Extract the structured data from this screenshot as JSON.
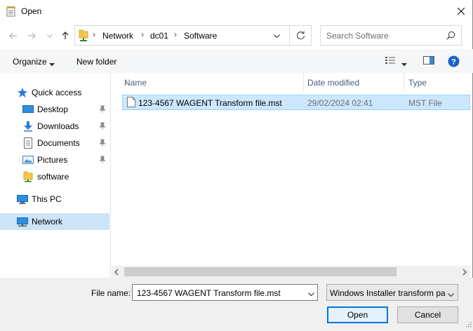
{
  "window": {
    "title": "Open"
  },
  "address": {
    "crumbs": [
      "Network",
      "dc01",
      "Software"
    ]
  },
  "search": {
    "placeholder": "Search Software"
  },
  "commands": {
    "organize": "Organize",
    "new_folder": "New folder"
  },
  "sidebar": {
    "items": [
      {
        "label": "Quick access",
        "icon": "star-icon"
      },
      {
        "label": "Desktop",
        "icon": "desktop-icon",
        "pinned": true
      },
      {
        "label": "Downloads",
        "icon": "download-icon",
        "pinned": true
      },
      {
        "label": "Documents",
        "icon": "documents-icon",
        "pinned": true
      },
      {
        "label": "Pictures",
        "icon": "pictures-icon",
        "pinned": true
      },
      {
        "label": "software",
        "icon": "folder-icon"
      },
      {
        "label": "This PC",
        "icon": "computer-icon"
      },
      {
        "label": "Network",
        "icon": "network-icon",
        "selected": true
      }
    ]
  },
  "columns": [
    "Name",
    "Date modified",
    "Type"
  ],
  "files": [
    {
      "name": "123-4567 WAGENT Transform file.mst",
      "date_modified": "29/02/2024 02:41",
      "type": "MST File",
      "selected": true
    }
  ],
  "footer": {
    "file_name_label": "File name:",
    "file_name_value": "123-4567 WAGENT Transform file.mst",
    "file_type_value": "Windows Installer transform pa",
    "open_label": "Open",
    "cancel_label": "Cancel"
  },
  "colors": {
    "accent": "#0078d7",
    "selection": "#cce8ff",
    "nav_selection": "#cce4f7"
  }
}
